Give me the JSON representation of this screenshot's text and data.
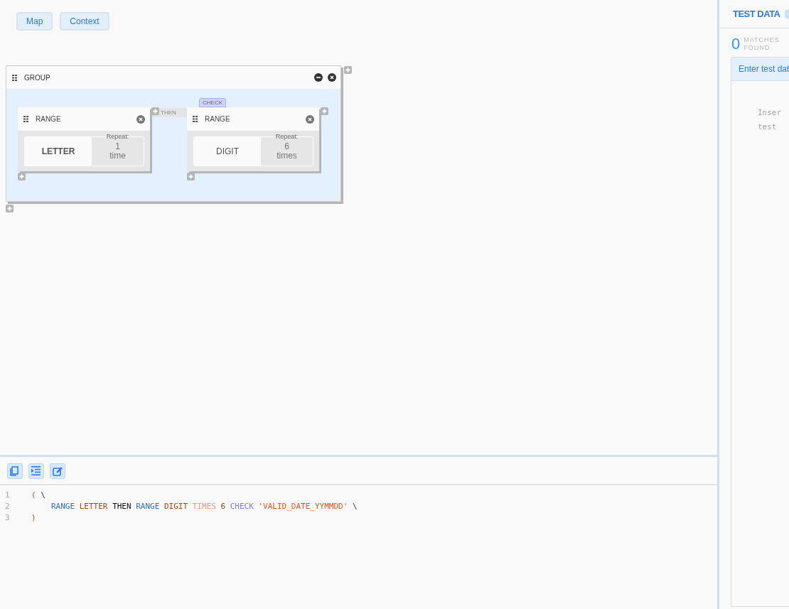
{
  "toolbar": {
    "buttons": [
      "Map",
      "Context"
    ]
  },
  "group": {
    "title": "GROUP",
    "ranges": [
      {
        "title": "RANGE",
        "value": "LETTER",
        "bold": true,
        "repeat_label": "Repeat:",
        "count": "1",
        "unit": "time"
      },
      {
        "title": "RANGE",
        "value": "DIGIT",
        "bold": false,
        "repeat_label": "Repeat:",
        "count": "6",
        "unit": "times"
      }
    ],
    "connector": "THEN",
    "check": "CHECK"
  },
  "editor": {
    "lines": [
      {
        "number": "1",
        "indented": false,
        "tokens": [
          {
            "text": "(",
            "kind": "paren"
          },
          {
            "text": "\\",
            "kind": "escape"
          }
        ]
      },
      {
        "number": "2",
        "indented": true,
        "tokens": [
          {
            "text": "RANGE",
            "kind": "keyword"
          },
          {
            "text": "LETTER",
            "kind": "class"
          },
          {
            "text": "THEN",
            "kind": "connective"
          },
          {
            "text": "RANGE",
            "kind": "keyword"
          },
          {
            "text": "DIGIT",
            "kind": "class"
          },
          {
            "text": "TIMES",
            "kind": "quantifier"
          },
          {
            "text": "6",
            "kind": "number"
          },
          {
            "text": "CHECK",
            "kind": "check"
          },
          {
            "text": "'VALID_DATE_YYMMDD'",
            "kind": "string"
          },
          {
            "text": "\\",
            "kind": "escape"
          }
        ]
      },
      {
        "number": "3",
        "indented": false,
        "tokens": [
          {
            "text": ")",
            "kind": "paren"
          }
        ]
      }
    ]
  },
  "test_data": {
    "title": "TEST DATA",
    "count": "0",
    "count_label": "MATCHES FOUND",
    "tab": "Enter test dat",
    "placeholder_lines": [
      "Inser",
      "test"
    ]
  }
}
